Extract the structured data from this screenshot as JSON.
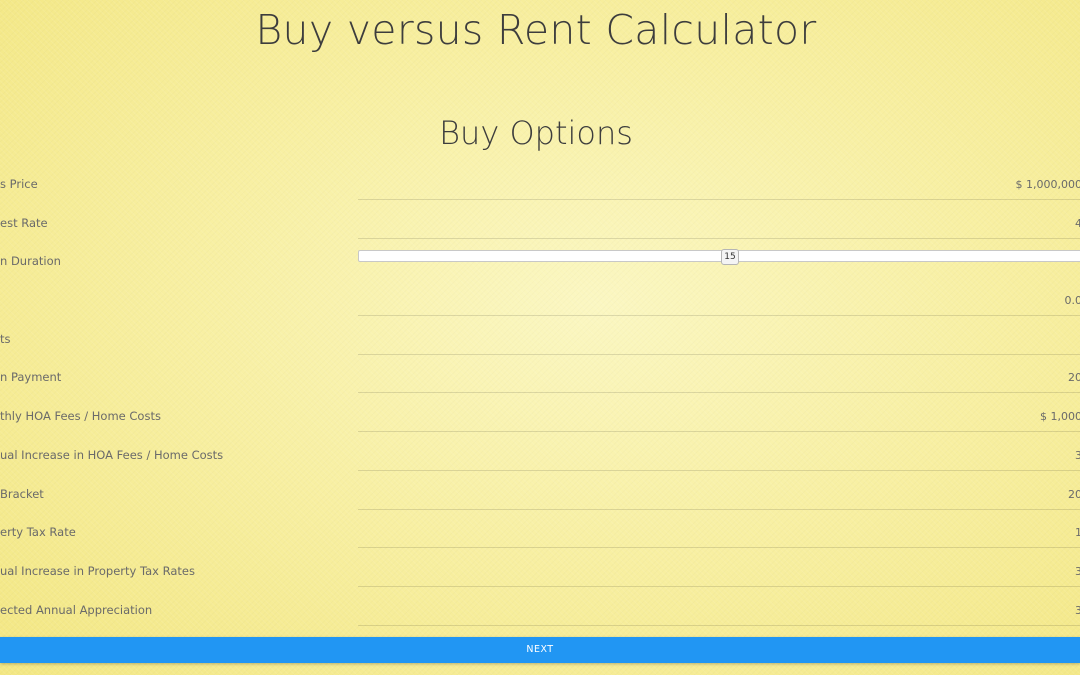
{
  "header": {
    "title": "Buy versus Rent Calculator"
  },
  "section": {
    "title": "Buy Options"
  },
  "fields": [
    {
      "label": "s Price",
      "value": "$ 1,000,000"
    },
    {
      "label": "est Rate",
      "value": "4"
    },
    {
      "label": "n Duration",
      "value": "15"
    },
    {
      "label": "",
      "value": "0.0"
    },
    {
      "label": "ts",
      "value": ""
    },
    {
      "label": "n Payment",
      "value": "20"
    },
    {
      "label": "thly HOA Fees / Home Costs",
      "value": "$ 1,000"
    },
    {
      "label": "ual Increase in HOA Fees / Home Costs",
      "value": "3"
    },
    {
      "label": "Bracket",
      "value": "20"
    },
    {
      "label": "erty Tax Rate",
      "value": "1"
    },
    {
      "label": "ual Increase in Property Tax Rates",
      "value": "3"
    },
    {
      "label": "ected Annual Appreciation",
      "value": "3"
    }
  ],
  "slider": {
    "value": "15"
  },
  "actions": {
    "next_label": "NEXT"
  },
  "colors": {
    "accent": "#2196f3",
    "background": "#f8f0a4"
  }
}
